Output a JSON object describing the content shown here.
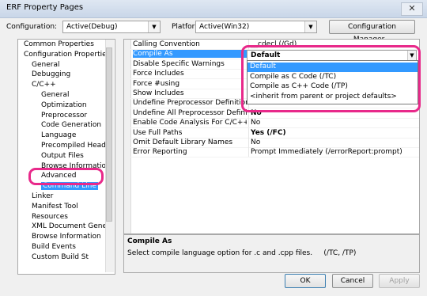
{
  "window": {
    "title": "ERF Property Pages",
    "close": "✕"
  },
  "toolbar": {
    "configuration_label": "Configuration:",
    "configuration_value": "Active(Debug)",
    "platform_label": "Platform:",
    "platform_value": "Active(Win32)",
    "config_manager_label": "Configuration Manager..."
  },
  "tree": {
    "items": [
      "Common Properties",
      "Configuration Properties",
      "General",
      "Debugging",
      "C/C++",
      "General",
      "Optimization",
      "Preprocessor",
      "Code Generation",
      "Language",
      "Precompiled Heade",
      "Output Files",
      "Browse Information",
      "Advanced",
      "Command Line",
      "Linker",
      "Manifest Tool",
      "Resources",
      "XML Document Genera",
      "Browse Information",
      "Build Events",
      "Custom Build St"
    ],
    "selected": "Advanced"
  },
  "properties": {
    "rows": [
      {
        "name": "Calling Convention",
        "value": "__cdecl (/Gd)"
      },
      {
        "name": "Compile As",
        "value": "Default"
      },
      {
        "name": "Disable Specific Warnings",
        "value": ""
      },
      {
        "name": "Force Includes",
        "value": ""
      },
      {
        "name": "Force #using",
        "value": ""
      },
      {
        "name": "Show Includes",
        "value": ""
      },
      {
        "name": "Undefine Preprocessor Definitions",
        "value": ""
      },
      {
        "name": "Undefine All Preprocessor Definitions",
        "value": "No"
      },
      {
        "name": "Enable Code Analysis For C/C++ on Bu",
        "value": "No"
      },
      {
        "name": "Use Full Paths",
        "value": "Yes (/FC)"
      },
      {
        "name": "Omit Default Library Names",
        "value": "No"
      },
      {
        "name": "Error Reporting",
        "value": "Prompt Immediately (/errorReport:prompt)"
      }
    ],
    "selected_row": "Compile As"
  },
  "compile_as_dropdown": {
    "current": "Default",
    "options": [
      "Default",
      "Compile as C Code (/TC)",
      "Compile as C++ Code (/TP)",
      "<inherit from parent or project defaults>"
    ],
    "highlighted": "Default"
  },
  "description": {
    "title": "Compile As",
    "text": "Select compile language option for .c and .cpp files.     (/TC, /TP)"
  },
  "buttons": {
    "ok": "OK",
    "cancel": "Cancel",
    "apply": "Apply"
  },
  "colors": {
    "highlight": "#3399ff",
    "annotation_ring": "#e8298a"
  }
}
